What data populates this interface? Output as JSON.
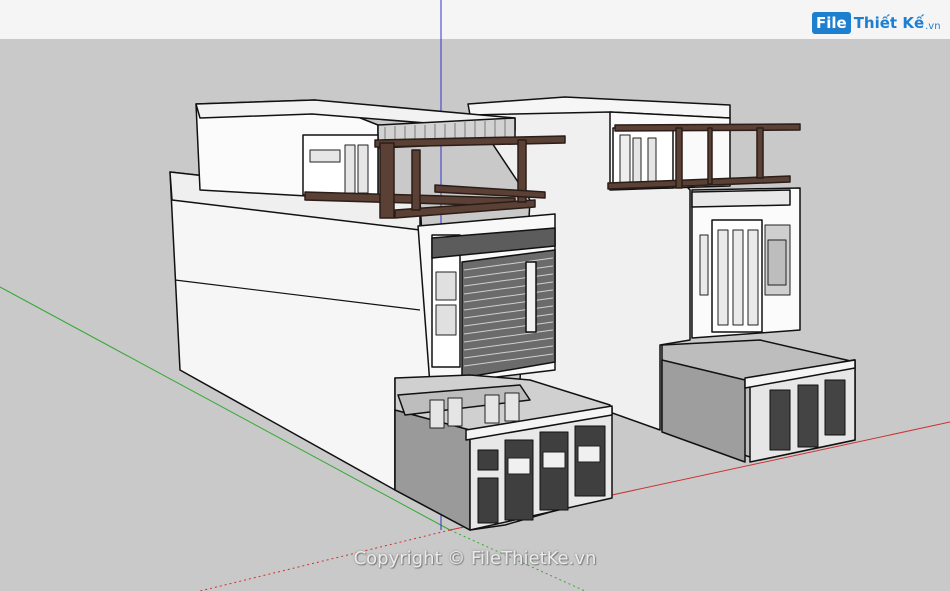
{
  "app": {
    "type": "3d-modeling-viewport",
    "sky_color": "#f5f5f5",
    "ground_color": "#c9c9c9"
  },
  "logo": {
    "box_text": "File",
    "text": "Thiết Kế",
    "tld": ".vn",
    "color": "#1e7fd0"
  },
  "watermark": {
    "text": "Copyright © FileThietKe.vn"
  },
  "axes": {
    "red": "#cc3333",
    "green": "#33aa33",
    "blue": "#3333cc"
  },
  "colors": {
    "wall_white": "#f8f8f8",
    "wall_shade": "#d8d8d8",
    "wall_dark": "#9a9a9a",
    "timber": "#5a4035",
    "grille": "#555555"
  }
}
